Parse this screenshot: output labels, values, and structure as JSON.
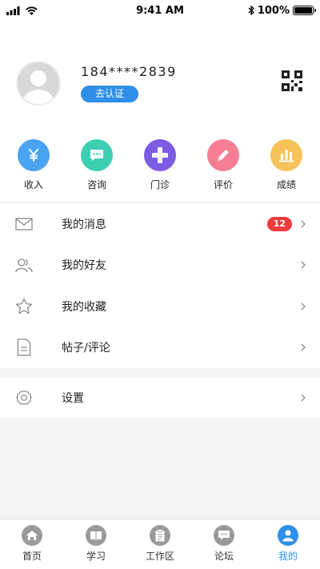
{
  "status_bar": {
    "time": "9:41 AM",
    "battery": "100%"
  },
  "profile": {
    "phone": "184****2839",
    "verify_label": "去认证"
  },
  "quick_actions": [
    {
      "label": "收入",
      "icon": "yen-icon",
      "color": "#4aa3f0"
    },
    {
      "label": "咨询",
      "icon": "chat-icon",
      "color": "#3ecfb3"
    },
    {
      "label": "门诊",
      "icon": "plus-icon",
      "color": "#7b5ce3"
    },
    {
      "label": "评价",
      "icon": "pencil-icon",
      "color": "#f57e95"
    },
    {
      "label": "成绩",
      "icon": "bar-chart-icon",
      "color": "#f6c25a"
    }
  ],
  "menu": {
    "messages": {
      "label": "我的消息",
      "badge": "12"
    },
    "friends": {
      "label": "我的好友"
    },
    "favorites": {
      "label": "我的收藏"
    },
    "posts": {
      "label": "帖子/评论"
    },
    "settings": {
      "label": "设置"
    }
  },
  "tabs": [
    {
      "label": "首页",
      "icon": "home-icon"
    },
    {
      "label": "学习",
      "icon": "book-icon"
    },
    {
      "label": "工作区",
      "icon": "clipboard-icon"
    },
    {
      "label": "论坛",
      "icon": "forum-icon"
    },
    {
      "label": "我的",
      "icon": "person-icon",
      "active": true
    }
  ],
  "colors": {
    "accent": "#2f8fe8",
    "badge": "#ee3b3b",
    "tab_inactive": "#9a9a9a"
  }
}
